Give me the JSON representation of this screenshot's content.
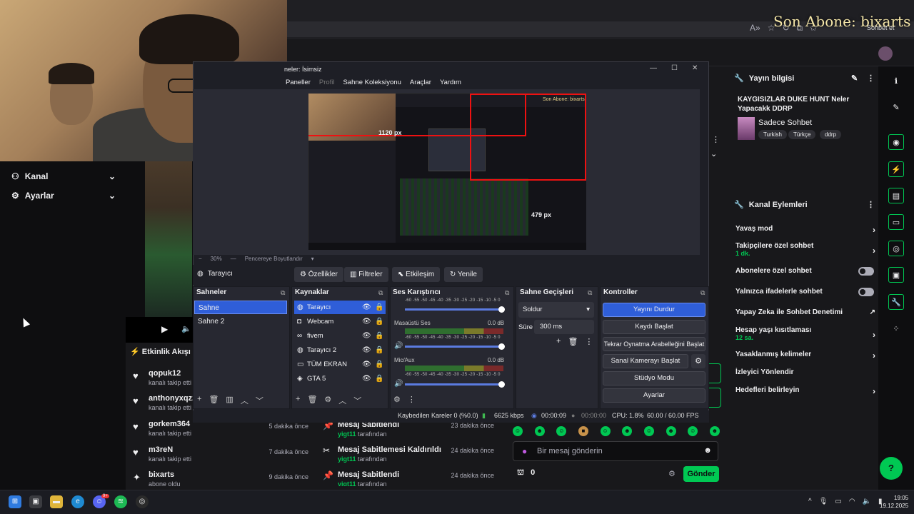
{
  "overlay": {
    "sub_alert": "Son Abone: bixarts"
  },
  "browser": {
    "copilot_label": "Sohbet et"
  },
  "sidebar": {
    "items": [
      {
        "label": "Kanal",
        "icon": "channel-icon"
      },
      {
        "label": "Ayarlar",
        "icon": "gear-icon"
      }
    ]
  },
  "activity_feed": {
    "title": "Etkinlik Akışı",
    "events": [
      {
        "name": "qopuk12",
        "action": "kanalı takip etti",
        "time": ""
      },
      {
        "name": "anthonyxqzz",
        "action": "kanalı takip etti",
        "time": ""
      },
      {
        "name": "gorkem364",
        "action": "kanalı takip etti",
        "time": "5 dakika önce"
      },
      {
        "name": "m3reN",
        "action": "kanalı takip etti",
        "time": "7 dakika önce"
      },
      {
        "name": "bixarts",
        "action": "abone oldu",
        "time": "9 dakika önce"
      }
    ]
  },
  "pinned_feed": {
    "events": [
      {
        "title": "Mesaj Sabitlendi",
        "by_user": "yigt11",
        "by_suffix": " tarafından",
        "time": "23 dakika önce"
      },
      {
        "title": "Mesaj Sabitlemesi Kaldırıldı",
        "by_user": "yigt11",
        "by_suffix": " tarafından",
        "time": "24 dakika önce"
      },
      {
        "title": "Mesaj Sabitlendi",
        "by_user": "yigt11",
        "by_suffix": " tarafından",
        "time": "24 dakika önce"
      }
    ]
  },
  "chat": {
    "placeholder": "Bir mesaj gönderin",
    "points": "0",
    "send_label": "Gönder"
  },
  "stream_info": {
    "header": "Yayın bilgisi",
    "title": "KAYGISIZLAR DUKE HUNT Neler Yapacakk DDRP",
    "category": "Sadece Sohbet",
    "tags": [
      "Turkish",
      "Türkçe",
      "ddrp"
    ]
  },
  "channel_actions": {
    "header": "Kanal Eylemleri",
    "items": [
      {
        "label": "Yavaş mod",
        "sub": "",
        "control": "chevron"
      },
      {
        "label": "Takipçilere özel sohbet",
        "sub": "1 dk.",
        "control": "chevron"
      },
      {
        "label": "Abonelere özel sohbet",
        "sub": "",
        "control": "toggle"
      },
      {
        "label": "Yalnızca ifadelerle sohbet",
        "sub": "",
        "control": "toggle"
      },
      {
        "label": "Yapay Zeka ile Sohbet Denetimi",
        "sub": "",
        "control": "external"
      },
      {
        "label": "Hesap yaşı kısıtlaması",
        "sub": "12 sa.",
        "control": "chevron"
      },
      {
        "label": "Yasaklanmış kelimeler",
        "sub": "",
        "control": "chevron"
      },
      {
        "label": "İzleyici Yönlendir",
        "sub": "",
        "control": "none"
      },
      {
        "label": "Hedefleri belirleyin",
        "sub": "",
        "control": "chevron"
      }
    ]
  },
  "obs": {
    "title": "neler: İsimsiz",
    "menu": [
      "Paneller",
      "Profil",
      "Sahne Koleksiyonu",
      "Araçlar",
      "Yardım"
    ],
    "preview": {
      "label_width": "1120 px",
      "label_height": "479 px",
      "inner_alert": "Son Abone: bixarts",
      "zoom": "30%",
      "fit_label": "Pencereye Boyutlandır"
    },
    "source_toolbar": {
      "selected_source": "Tarayıcı",
      "buttons": [
        "Özellikler",
        "Filtreler",
        "Etkileşim",
        "Yenile"
      ]
    },
    "scenes": {
      "header": "Sahneler",
      "items": [
        "Sahne",
        "Sahne 2"
      ]
    },
    "sources": {
      "header": "Kaynaklar",
      "items": [
        {
          "name": "Tarayıcı",
          "icon": "globe-icon"
        },
        {
          "name": "Webcam",
          "icon": "camera-icon"
        },
        {
          "name": "fivem",
          "icon": "link-icon"
        },
        {
          "name": "Tarayıcı 2",
          "icon": "globe-icon"
        },
        {
          "name": "TÜM EKRAN",
          "icon": "monitor-icon"
        },
        {
          "name": "GTA 5",
          "icon": "gamepad-icon"
        }
      ]
    },
    "mixer": {
      "header": "Ses Karıştırıcı",
      "scale": "-60 -55 -50 -45 -40 -35 -30 -25 -20 -15 -10 -5 0",
      "channels": [
        {
          "name": "Masaüstü Ses",
          "db": "0.0 dB"
        },
        {
          "name": "Mic/Aux",
          "db": "0.0 dB"
        }
      ]
    },
    "transitions": {
      "header": "Sahne Geçişleri",
      "type": "Soldur",
      "duration_label": "Süre",
      "duration": "300 ms"
    },
    "controls": {
      "header": "Kontroller",
      "buttons": [
        "Yayını Durdur",
        "Kaydı Başlat",
        "Tekrar Oynatma Arabelleğini Başlat",
        "Sanal Kamerayı Başlat",
        "Stüdyo Modu",
        "Ayarlar"
      ]
    },
    "status": {
      "dropped": "Kaybedilen Kareler 0 (%0.0)",
      "bitrate": "6625 kbps",
      "stream_time": "00:00:09",
      "rec_time": "00:00:00",
      "cpu": "CPU: 1.8%",
      "fps": "60.00 / 60.00 FPS"
    }
  },
  "taskbar": {
    "time": "19:05",
    "date": "19.12.2025",
    "badge": "9+"
  },
  "colors": {
    "accent_green": "#00c853",
    "obs_blue": "#2f5ed8",
    "twitch_bg": "#18181b"
  }
}
